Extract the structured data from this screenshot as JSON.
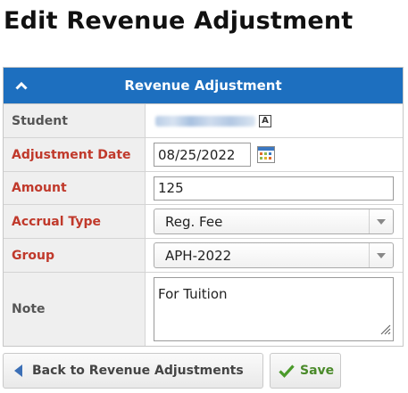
{
  "page": {
    "title": "Edit Revenue Adjustment"
  },
  "panel": {
    "header": "Revenue Adjustment",
    "collapse_icon": "chevron-up-icon",
    "brand_color": "#1d6fbf"
  },
  "fields": {
    "student": {
      "label": "Student",
      "link_icon": "student-link-icon",
      "link_icon_glyph": "A"
    },
    "adjustment_date": {
      "label": "Adjustment Date",
      "value": "08/25/2022",
      "icon": "calendar-icon"
    },
    "amount": {
      "label": "Amount",
      "value": "125"
    },
    "accrual_type": {
      "label": "Accrual Type",
      "value": "Reg. Fee"
    },
    "group": {
      "label": "Group",
      "value": "APH-2022"
    },
    "note": {
      "label": "Note",
      "value": "For Tuition"
    }
  },
  "required_color": "#c0392b",
  "actions": {
    "back": {
      "label": "Back to Revenue Adjustments",
      "icon": "arrow-left-icon"
    },
    "save": {
      "label": "Save",
      "icon": "checkmark-icon",
      "color": "#4a8a2a"
    }
  }
}
